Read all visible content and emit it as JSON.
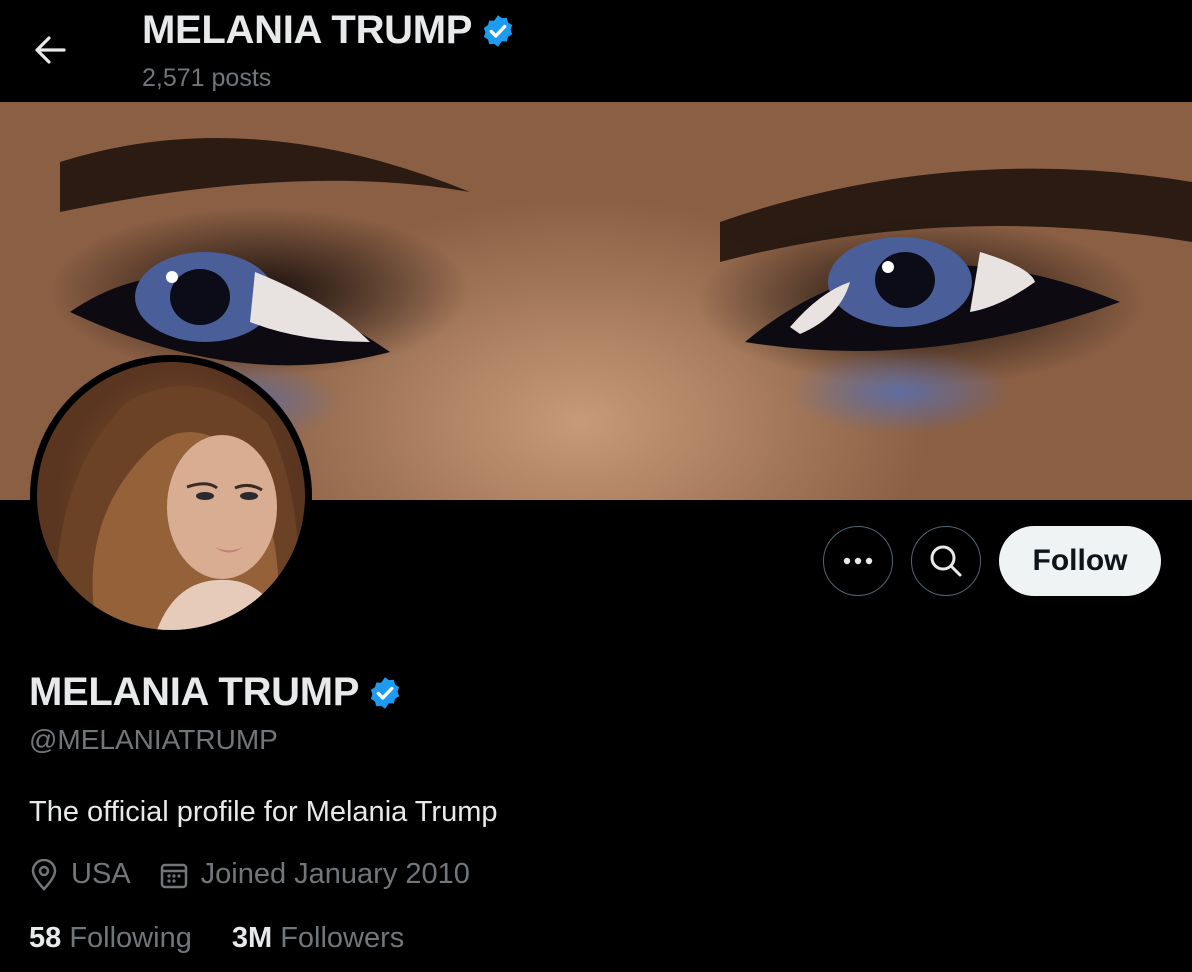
{
  "header": {
    "name": "MELANIA TRUMP",
    "posts": "2,571 posts"
  },
  "profile": {
    "name": "MELANIA TRUMP",
    "handle": "@MELANIATRUMP",
    "bio": "The official profile for Melania Trump",
    "location": "USA",
    "joined": "Joined January 2010",
    "following_count": "58",
    "following_label": "Following",
    "followers_count": "3M",
    "followers_label": "Followers"
  },
  "actions": {
    "follow_label": "Follow"
  },
  "icons": {
    "back": "arrow-left-icon",
    "verified": "verified-badge-icon",
    "more": "more-dots-icon",
    "search": "search-icon",
    "location": "location-pin-icon",
    "calendar": "calendar-icon"
  },
  "colors": {
    "background": "#000000",
    "text": "#e7e9ea",
    "muted": "#71767b",
    "verified": "#1d9bf0",
    "follow_bg": "#eff3f4"
  }
}
